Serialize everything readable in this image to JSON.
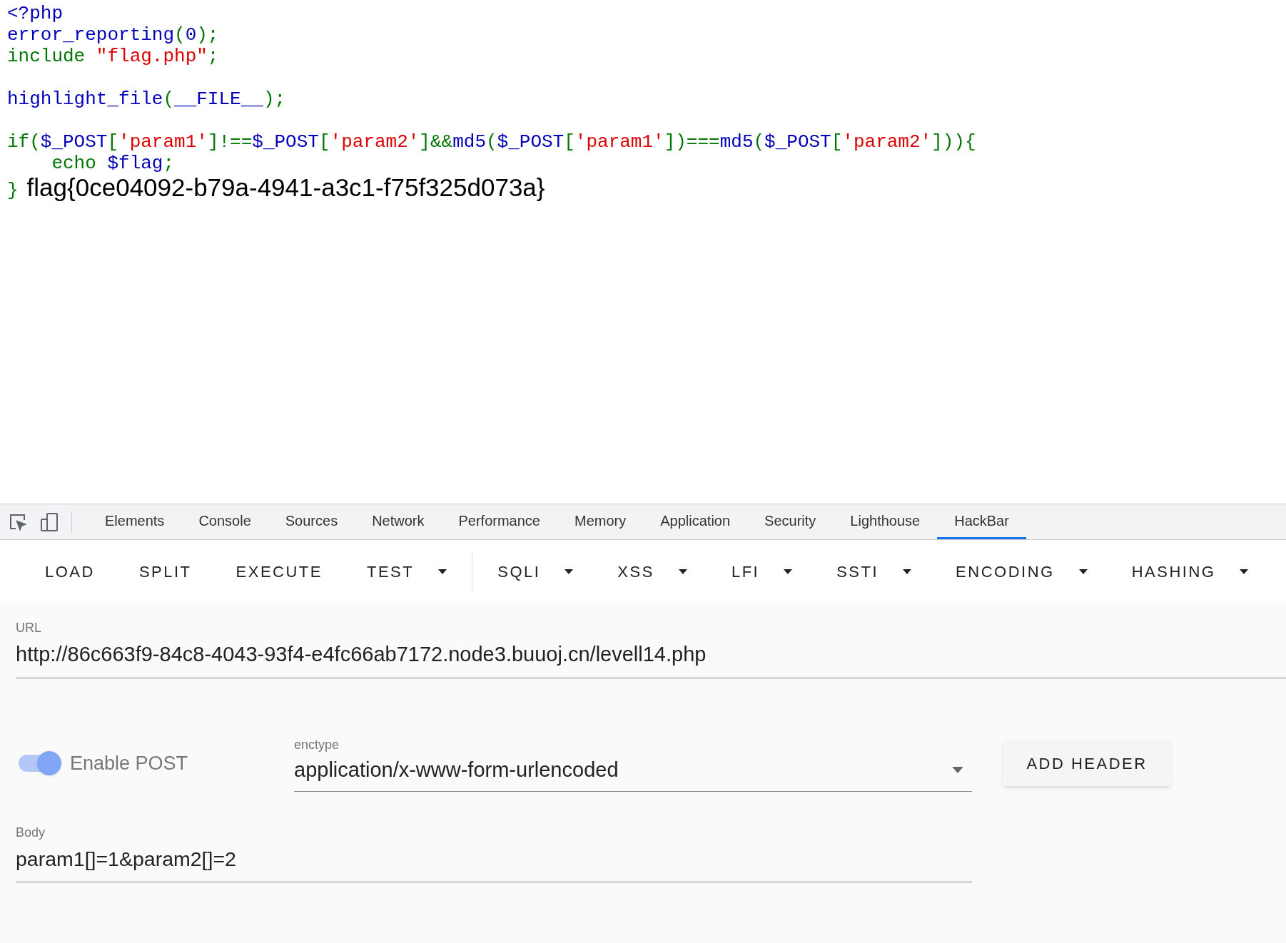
{
  "source_code": {
    "blocks": [
      {
        "lines": [
          {
            "tokens": [
              {
                "text": "<?php",
                "color": "#0000bb"
              }
            ]
          },
          {
            "tokens": [
              {
                "text": "error_reporting",
                "color": "#0000bb"
              },
              {
                "text": "(",
                "color": "#007700"
              },
              {
                "text": "0",
                "color": "#0000bb"
              },
              {
                "text": ");",
                "color": "#007700"
              }
            ]
          },
          {
            "tokens": [
              {
                "text": "include ",
                "color": "#007700"
              },
              {
                "text": "\"flag.php\"",
                "color": "#dd0000"
              },
              {
                "text": ";",
                "color": "#007700"
              }
            ]
          }
        ]
      },
      {
        "lines": [
          {
            "tokens": [
              {
                "text": "highlight_file",
                "color": "#0000bb"
              },
              {
                "text": "(",
                "color": "#007700"
              },
              {
                "text": "__FILE__",
                "color": "#0000bb"
              },
              {
                "text": ");",
                "color": "#007700"
              }
            ]
          }
        ]
      },
      {
        "lines": [
          {
            "tokens": [
              {
                "text": "if(",
                "color": "#007700"
              },
              {
                "text": "$_POST",
                "color": "#0000bb"
              },
              {
                "text": "[",
                "color": "#007700"
              },
              {
                "text": "'param1'",
                "color": "#dd0000"
              },
              {
                "text": "]!==",
                "color": "#007700"
              },
              {
                "text": "$_POST",
                "color": "#0000bb"
              },
              {
                "text": "[",
                "color": "#007700"
              },
              {
                "text": "'param2'",
                "color": "#dd0000"
              },
              {
                "text": "]&&",
                "color": "#007700"
              },
              {
                "text": "md5",
                "color": "#0000bb"
              },
              {
                "text": "(",
                "color": "#007700"
              },
              {
                "text": "$_POST",
                "color": "#0000bb"
              },
              {
                "text": "[",
                "color": "#007700"
              },
              {
                "text": "'param1'",
                "color": "#dd0000"
              },
              {
                "text": "])===",
                "color": "#007700"
              },
              {
                "text": "md5",
                "color": "#0000bb"
              },
              {
                "text": "(",
                "color": "#007700"
              },
              {
                "text": "$_POST",
                "color": "#0000bb"
              },
              {
                "text": "[",
                "color": "#007700"
              },
              {
                "text": "'param2'",
                "color": "#dd0000"
              },
              {
                "text": "])){",
                "color": "#007700"
              }
            ]
          },
          {
            "tokens": [
              {
                "text": "    echo ",
                "color": "#007700"
              },
              {
                "text": "$flag",
                "color": "#0000bb"
              },
              {
                "text": ";",
                "color": "#007700"
              }
            ]
          },
          {
            "tokens": [
              {
                "text": "}",
                "color": "#007700"
              }
            ],
            "output": "flag{0ce04092-b79a-4941-a3c1-f75f325d073a}"
          }
        ]
      }
    ]
  },
  "devtools": {
    "tabs": [
      {
        "label": "Elements",
        "selected": false
      },
      {
        "label": "Console",
        "selected": false
      },
      {
        "label": "Sources",
        "selected": false
      },
      {
        "label": "Network",
        "selected": false
      },
      {
        "label": "Performance",
        "selected": false
      },
      {
        "label": "Memory",
        "selected": false
      },
      {
        "label": "Application",
        "selected": false
      },
      {
        "label": "Security",
        "selected": false
      },
      {
        "label": "Lighthouse",
        "selected": false
      },
      {
        "label": "HackBar",
        "selected": true
      }
    ]
  },
  "hackbar": {
    "toolbar": [
      {
        "label": "LOAD",
        "dropdown": false
      },
      {
        "label": "SPLIT",
        "dropdown": false
      },
      {
        "label": "EXECUTE",
        "dropdown": false
      },
      {
        "label": "TEST",
        "dropdown": true,
        "separator_after": true
      },
      {
        "label": "SQLI",
        "dropdown": true
      },
      {
        "label": "XSS",
        "dropdown": true
      },
      {
        "label": "LFI",
        "dropdown": true
      },
      {
        "label": "SSTI",
        "dropdown": true
      },
      {
        "label": "ENCODING",
        "dropdown": true
      },
      {
        "label": "HASHING",
        "dropdown": true
      }
    ],
    "url": {
      "label": "URL",
      "value": "http://86c663f9-84c8-4043-93f4-e4fc66ab7172.node3.buuoj.cn/levell14.php"
    },
    "enable_post": {
      "label": "Enable POST",
      "on": true
    },
    "enctype": {
      "label": "enctype",
      "value": "application/x-www-form-urlencoded"
    },
    "add_header": {
      "label": "ADD HEADER"
    },
    "body": {
      "label": "Body",
      "value": "param1[]=1&param2[]=2"
    }
  }
}
